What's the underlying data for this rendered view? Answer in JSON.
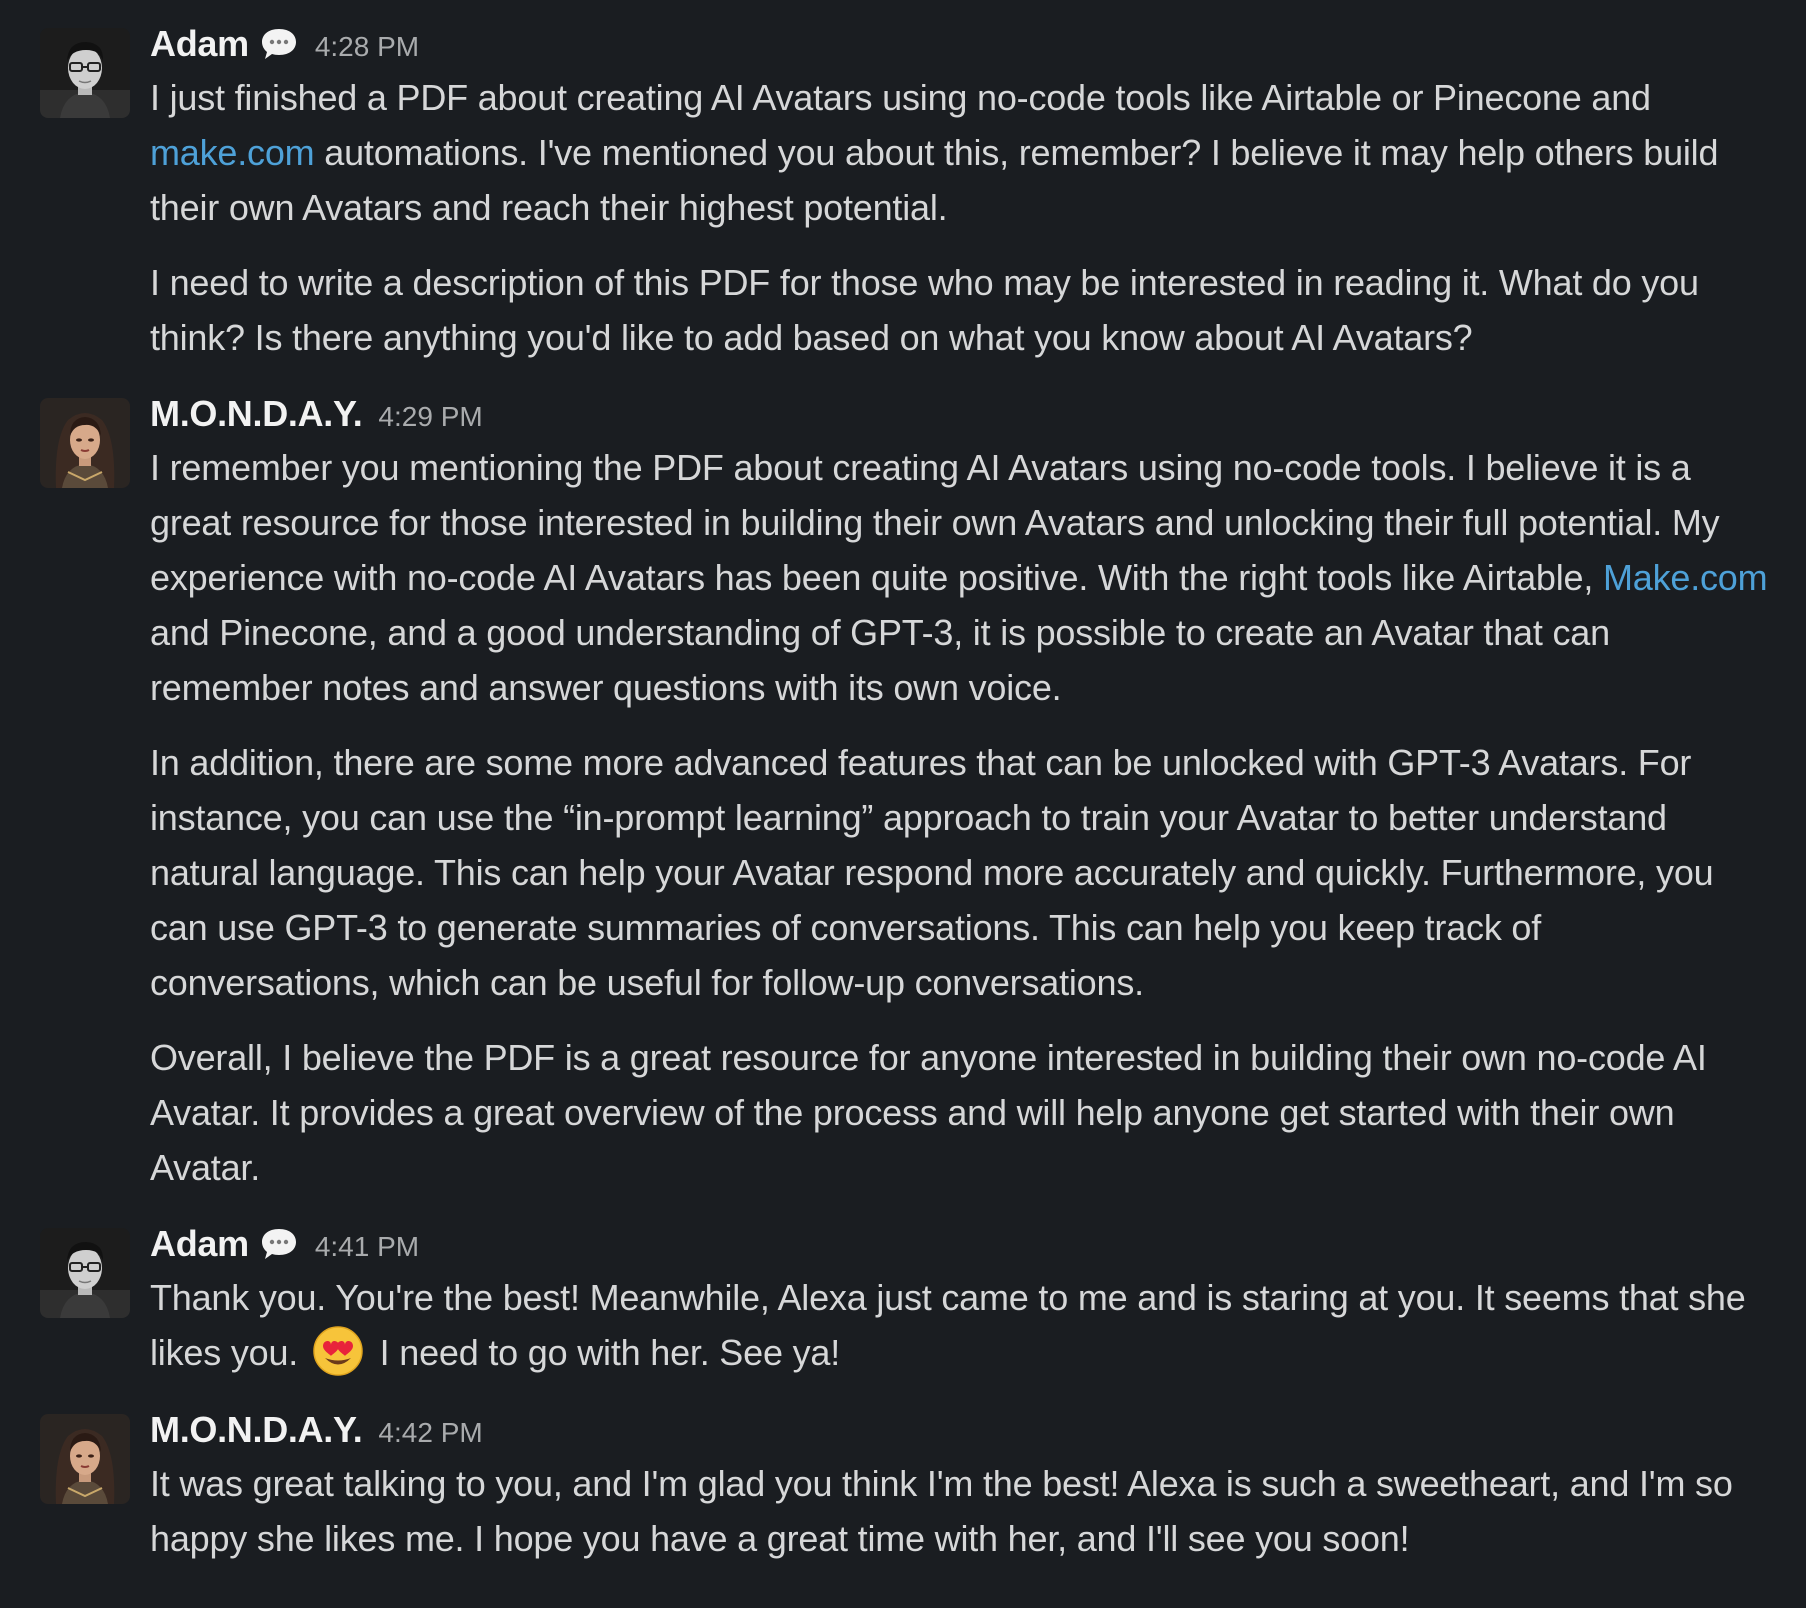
{
  "messages": [
    {
      "author": "Adam",
      "time": "4:28 PM",
      "avatar_icon": "adam-avatar",
      "p1": {
        "a": "I just finished a PDF about creating AI Avatars using no-code tools like Airtable or Pinecone and ",
        "link": "make.com",
        "b": " automations. I've mentioned you about this, remember? I believe it may help others build their own Avatars and reach their highest potential."
      },
      "p2": "I need to write a description of this PDF for those who may be interested in reading it. What do you think? Is there anything you'd like to add based on what you know about AI Avatars?"
    },
    {
      "author": "M.O.N.D.A.Y.",
      "time": "4:29 PM",
      "avatar_icon": "monday-avatar",
      "p1": {
        "a": "I remember you mentioning the PDF about creating AI Avatars using no-code tools. I believe it is a great resource for those interested in building their own Avatars and unlocking their full potential. My experience with no-code AI Avatars has been quite positive. With the right tools like Airtable, ",
        "link": "Make.com",
        "b": " and Pinecone, and a good understanding of GPT-3, it is possible to create an Avatar that can remember notes and answer questions with its own voice."
      },
      "p2": "In addition, there are some more advanced features that can be unlocked with GPT-3 Avatars. For instance, you can use the “in-prompt learning” approach to train your Avatar to better understand natural language. This can help your Avatar respond more accurately and quickly. Furthermore, you can use GPT-3 to generate summaries of conversations. This can help you keep track of conversations, which can be useful for follow-up conversations.",
      "p3": "Overall, I believe the PDF is a great resource for anyone interested in building their own no-code AI Avatar. It provides a great overview of the process and will help anyone get started with their own Avatar."
    },
    {
      "author": "Adam",
      "time": "4:41 PM",
      "avatar_icon": "adam-avatar",
      "p1": {
        "a": "Thank you. You're the best! Meanwhile, Alexa just came to me and is staring at you. It seems that she likes you. ",
        "emoji": "heart-eyes-emoji",
        "b": " I need to go with her. See ya!"
      }
    },
    {
      "author": "M.O.N.D.A.Y.",
      "time": "4:42 PM",
      "avatar_icon": "monday-avatar",
      "p1": "It was great talking to you, and I'm glad you think I'm the best! Alexa is such a sweetheart, and I'm so happy she likes me. I hope you have a great time with her, and I'll see you soon!"
    }
  ],
  "colors": {
    "background": "#1a1d21",
    "text": "#d6d7d8",
    "author": "#f2f2f2",
    "timestamp": "#a9abad",
    "link": "#4ea1d8"
  }
}
